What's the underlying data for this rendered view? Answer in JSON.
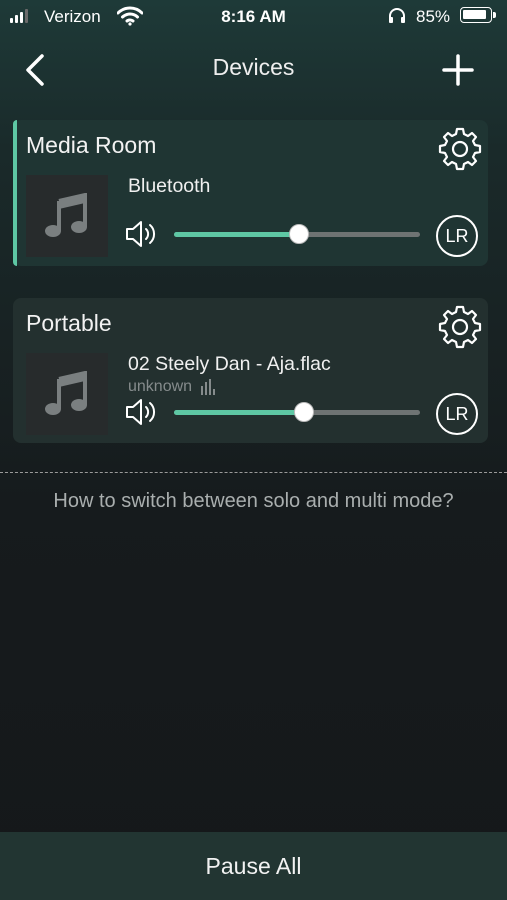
{
  "status_bar": {
    "carrier": "Verizon",
    "time": "8:16 AM",
    "battery_percent": "85%",
    "icons": [
      "signal-icon",
      "wifi-icon",
      "headphones-icon",
      "battery-icon"
    ]
  },
  "nav": {
    "title": "Devices",
    "back_icon": "chevron-left-icon",
    "add_icon": "plus-icon"
  },
  "devices": [
    {
      "name": "Media Room",
      "source": "Bluetooth",
      "subtitle": "",
      "volume": 0.51,
      "channel": "LR",
      "active": true
    },
    {
      "name": "Portable",
      "source": "02 Steely Dan - Aja.flac",
      "subtitle": "unknown",
      "volume": 0.53,
      "channel": "LR",
      "active": false
    }
  ],
  "help_text": "How to switch between solo and multi mode?",
  "footer": {
    "pause_all_label": "Pause All"
  },
  "colors": {
    "accent": "#5ec7a4",
    "track": "#6e7373",
    "card": "#23302f"
  }
}
